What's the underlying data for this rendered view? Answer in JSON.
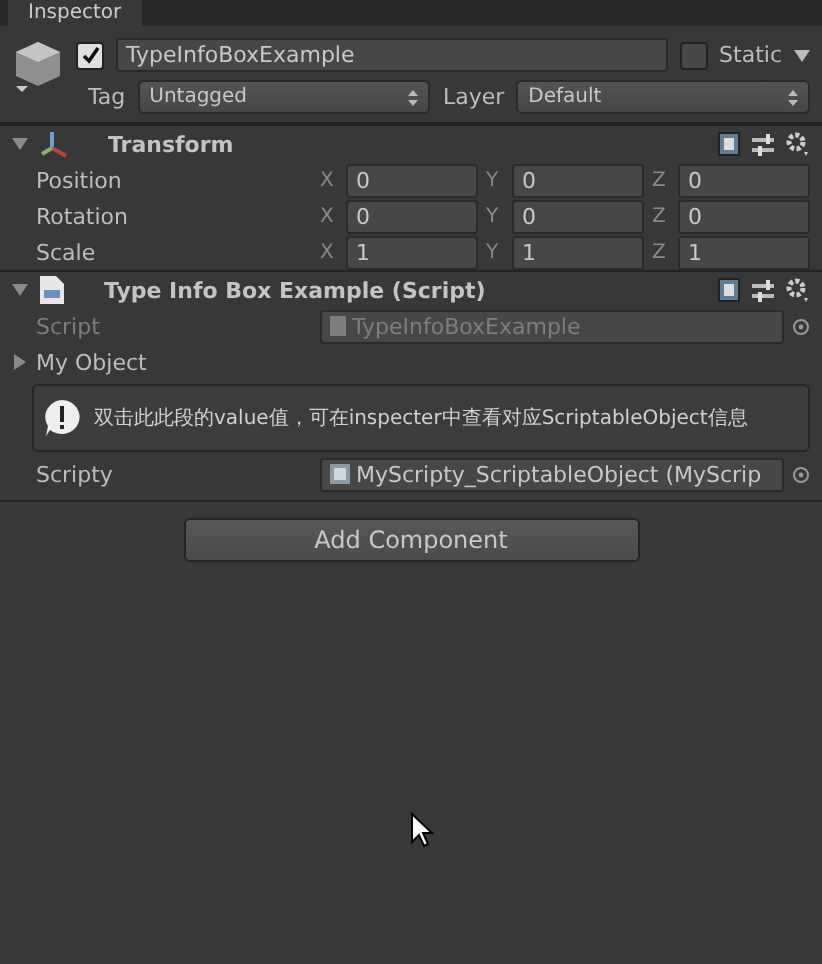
{
  "tab": {
    "title": "Inspector"
  },
  "object": {
    "active": true,
    "name": "TypeInfoBoxExample",
    "static": false,
    "static_label": "Static",
    "tag_label": "Tag",
    "tag": "Untagged",
    "layer_label": "Layer",
    "layer": "Default"
  },
  "components": [
    {
      "kind": "transform",
      "title": "Transform",
      "expanded": true,
      "rows": [
        {
          "label": "Position",
          "values": [
            {
              "axis": "X",
              "value": "0"
            },
            {
              "axis": "Y",
              "value": "0"
            },
            {
              "axis": "Z",
              "value": "0"
            }
          ]
        },
        {
          "label": "Rotation",
          "values": [
            {
              "axis": "X",
              "value": "0"
            },
            {
              "axis": "Y",
              "value": "0"
            },
            {
              "axis": "Z",
              "value": "0"
            }
          ]
        },
        {
          "label": "Scale",
          "values": [
            {
              "axis": "X",
              "value": "1"
            },
            {
              "axis": "Y",
              "value": "1"
            },
            {
              "axis": "Z",
              "value": "1"
            }
          ]
        }
      ]
    },
    {
      "kind": "script",
      "title": "Type Info Box Example (Script)",
      "expanded": true,
      "script_label": "Script",
      "script_value": "TypeInfoBoxExample",
      "foldout": {
        "label": "My Object",
        "expanded": false
      },
      "info": "双击此此段的value值，可在inspecter中查看对应ScriptableObject信息",
      "field_label": "Scripty",
      "field_value": "MyScripty_ScriptableObject (MyScrip"
    }
  ],
  "add_button": "Add Component"
}
